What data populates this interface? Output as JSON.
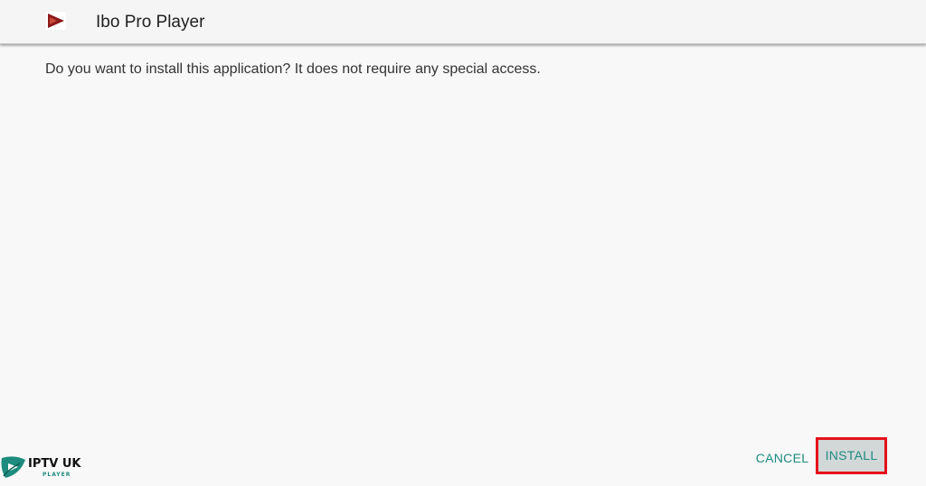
{
  "header": {
    "app_name": "Ibo Pro Player",
    "app_icon": "ibo-pro-player-app-icon"
  },
  "dialog": {
    "message": "Do you want to install this application? It does not require any special access."
  },
  "actions": {
    "cancel_label": "CANCEL",
    "install_label": "INSTALL",
    "highlight_color": "#e3121b",
    "accent_color": "#1d8b7d"
  },
  "watermark": {
    "text": "IPTV UK",
    "subtext": "PLAYER",
    "icon": "play-leaf-logo"
  }
}
